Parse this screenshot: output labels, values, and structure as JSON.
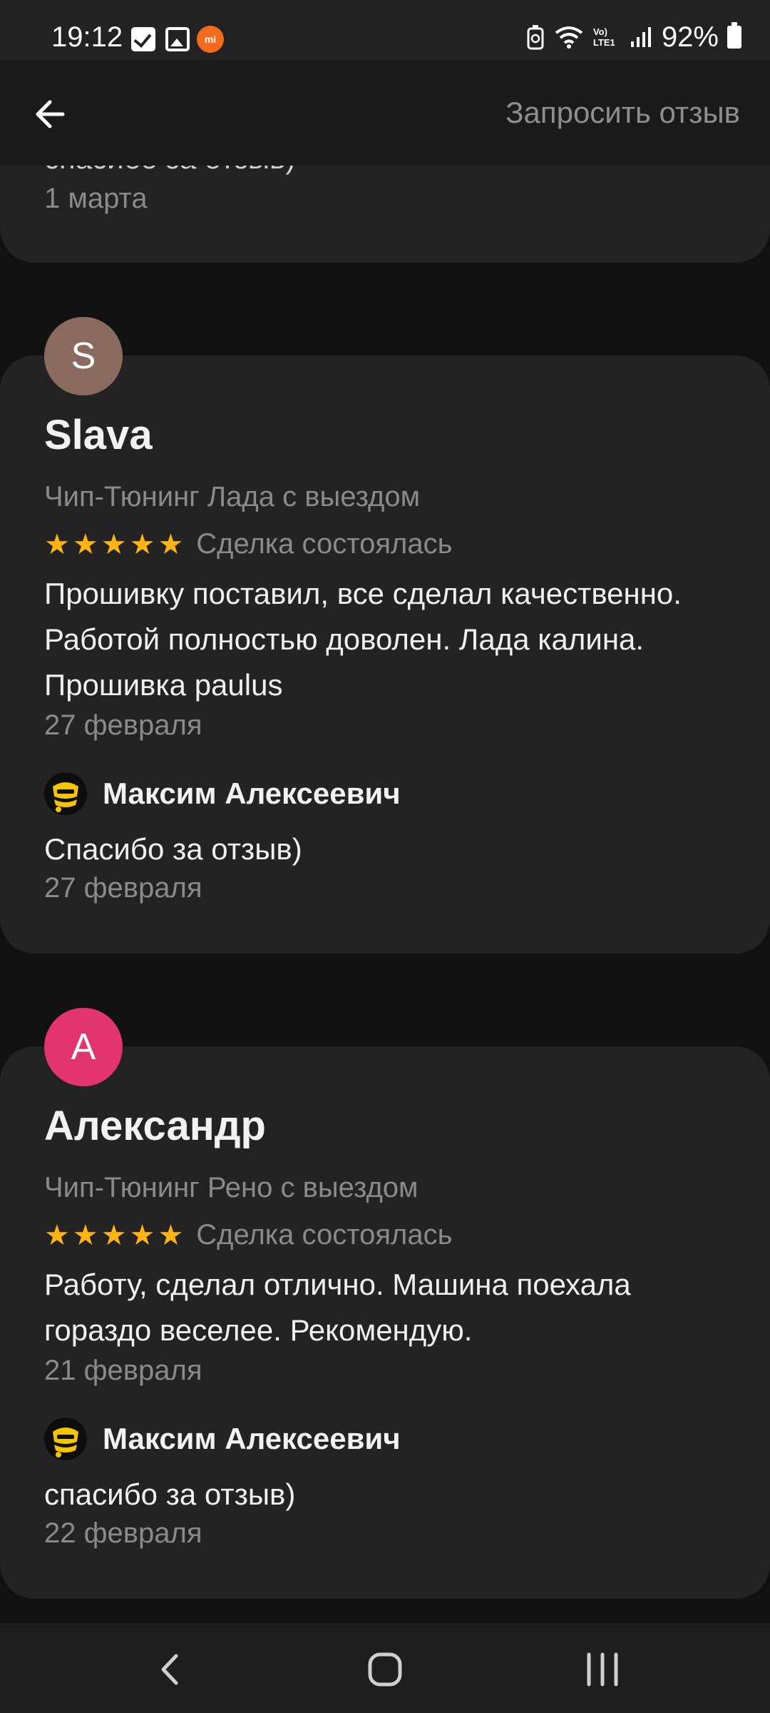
{
  "status_bar": {
    "time": "19:12",
    "network": "Vo) LTE1",
    "battery_pct": "92%"
  },
  "app_bar": {
    "action_label": "Запросить отзыв"
  },
  "top_card": {
    "reply_text_partial": "спасибо за отзыв)",
    "date": "1 марта"
  },
  "reviews": [
    {
      "avatar_letter": "S",
      "avatar_color": "#8b6a5f",
      "name": "Slava",
      "service": "Чип-Тюнинг Лада с выездом",
      "stars": 5,
      "status": "Сделка состоялась",
      "text": "Прошивку поставил, все сделал качественно. Работой полностью доволен. Лада калина. Прошивка paulus",
      "date": "27 февраля",
      "reply": {
        "author": "Максим Алексеевич",
        "text": "Спасибо за отзыв)",
        "date": "27 февраля"
      }
    },
    {
      "avatar_letter": "А",
      "avatar_color": "#e2346d",
      "name": "Александр",
      "service": "Чип-Тюнинг Рено с выездом",
      "stars": 5,
      "status": "Сделка состоялась",
      "text": "Работу, сделал отлично. Машина поехала гораздо веселее. Рекомендую.",
      "date": "21 февраля",
      "reply": {
        "author": "Максим Алексеевич",
        "text": "спасибо за отзыв)",
        "date": "22 февраля"
      }
    }
  ],
  "colors": {
    "star": "#ffb414",
    "card": "#232323",
    "background": "#111111",
    "muted": "#8a8a8a"
  }
}
